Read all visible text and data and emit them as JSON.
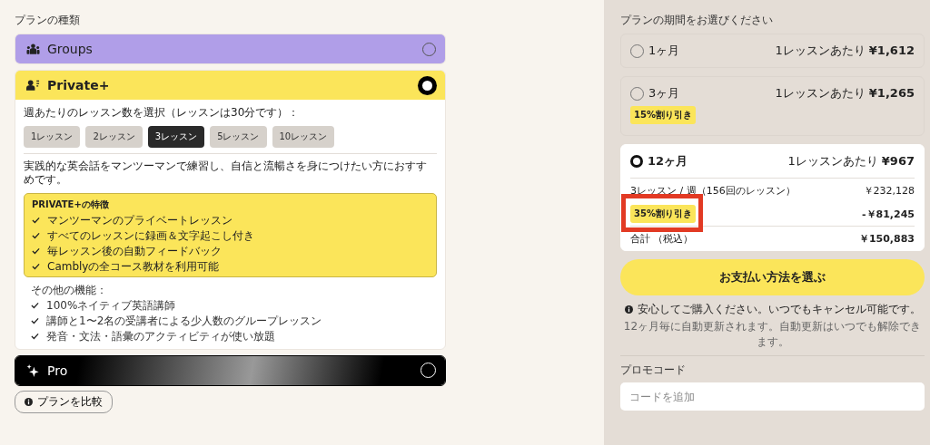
{
  "plan_type": {
    "label": "プランの種類",
    "plans": [
      {
        "name": "Groups",
        "kind": "groups",
        "selected": false
      },
      {
        "name": "Private+",
        "kind": "private",
        "selected": true,
        "details": {
          "lessons_prompt": "週あたりのレッスン数を選択（レッスンは30分です）：",
          "lesson_options": [
            {
              "label": "1レッスン",
              "selected": false
            },
            {
              "label": "2レッスン",
              "selected": false
            },
            {
              "label": "3レッスン",
              "selected": true
            },
            {
              "label": "5レッスン",
              "selected": false
            },
            {
              "label": "10レッスン",
              "selected": false
            }
          ],
          "description": "実践的な英会話をマンツーマンで練習し、自信と流暢さを身につけたい方におすすめです。",
          "features_title": "PRIVATE+の特徴",
          "features": [
            "マンツーマンのプライベートレッスン",
            "すべてのレッスンに録画＆文字起こし付き",
            "毎レッスン後の自動フィードバック",
            "Camblyの全コース教材を利用可能"
          ],
          "other_title": "その他の機能：",
          "other_features": [
            "100%ネイティブ英語講師",
            "講師と1〜2名の受講者による少人数のグループレッスン",
            "発音・文法・語彙のアクティビティが使い放題"
          ]
        }
      },
      {
        "name": "Pro",
        "kind": "pro",
        "selected": false
      }
    ]
  },
  "compare_button": "プランを比較",
  "duration": {
    "label": "プランの期間をお選びください",
    "options": [
      {
        "name": "1ヶ月",
        "price_label": "1レッスンあたり",
        "price": "¥1,612",
        "selected": false
      },
      {
        "name": "3ヶ月",
        "price_label": "1レッスンあたり",
        "price": "¥1,265",
        "selected": false,
        "badge": "15%割り引き"
      },
      {
        "name": "12ヶ月",
        "price_label": "1レッスンあたり",
        "price": "¥967",
        "selected": true,
        "breakdown": {
          "lessons_text": "3レッスン / 週（156回のレッスン）",
          "subtotal": "￥232,128",
          "discount_badge": "35%割り引き",
          "discount_highlighted": true,
          "discount": "-￥81,245",
          "total_label": "合計 （税込）",
          "total": "￥150,883"
        }
      }
    ]
  },
  "pay_button": "お支払い方法を選ぶ",
  "notice": "安心してご購入ください。いつでもキャンセル可能です。",
  "renewal_note": "12ヶ月毎に自動更新されます。自動更新はいつでも解除できます。",
  "promo": {
    "label": "プロモコード",
    "placeholder": "コードを追加"
  }
}
